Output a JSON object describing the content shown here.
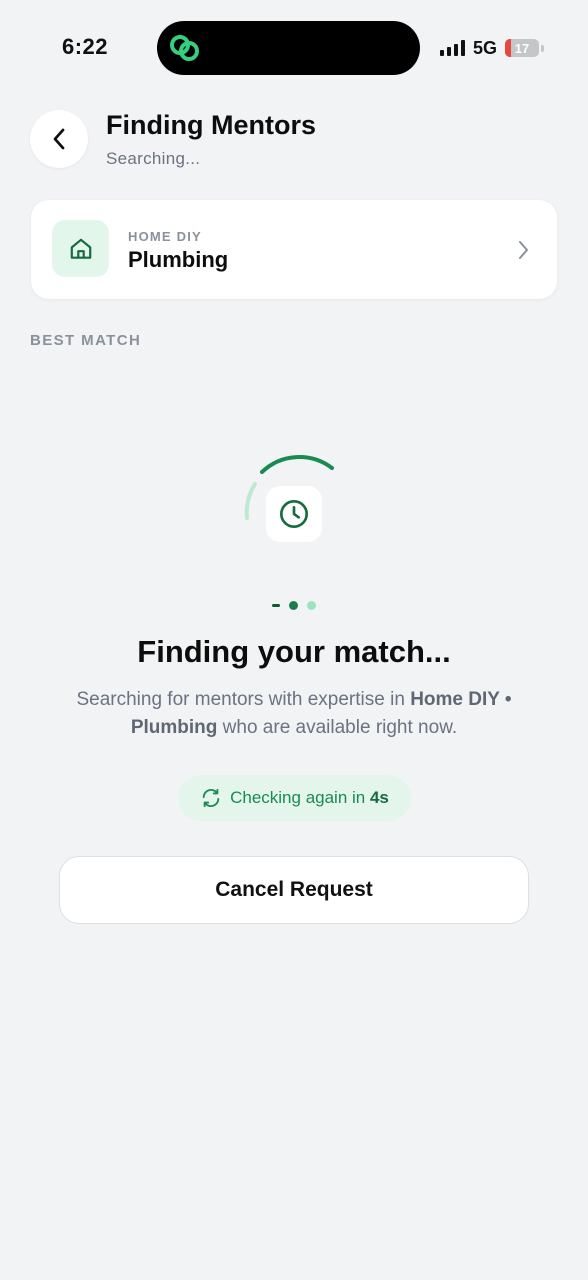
{
  "status_bar": {
    "time": "6:22",
    "network": "5G",
    "battery": "17",
    "battery_level": 0.17
  },
  "header": {
    "title": "Finding Mentors",
    "subtitle": "Searching..."
  },
  "category": {
    "label": "HOME DIY",
    "name": "Plumbing",
    "icon": "home-icon"
  },
  "section": {
    "label": "BEST MATCH"
  },
  "loading": {
    "icon": "clock-icon",
    "headline": "Finding your match...",
    "description_prefix": "Searching for mentors with expertise in ",
    "description_bold": "Home DIY • Plumbing",
    "description_suffix": " who are available right now."
  },
  "checking": {
    "text": "Checking again in ",
    "seconds": "4s",
    "icon": "refresh-icon"
  },
  "actions": {
    "cancel_label": "Cancel Request"
  },
  "colors": {
    "accent": "#1a8a53",
    "accent_light": "#e4f6ec",
    "background": "#f2f3f5"
  }
}
